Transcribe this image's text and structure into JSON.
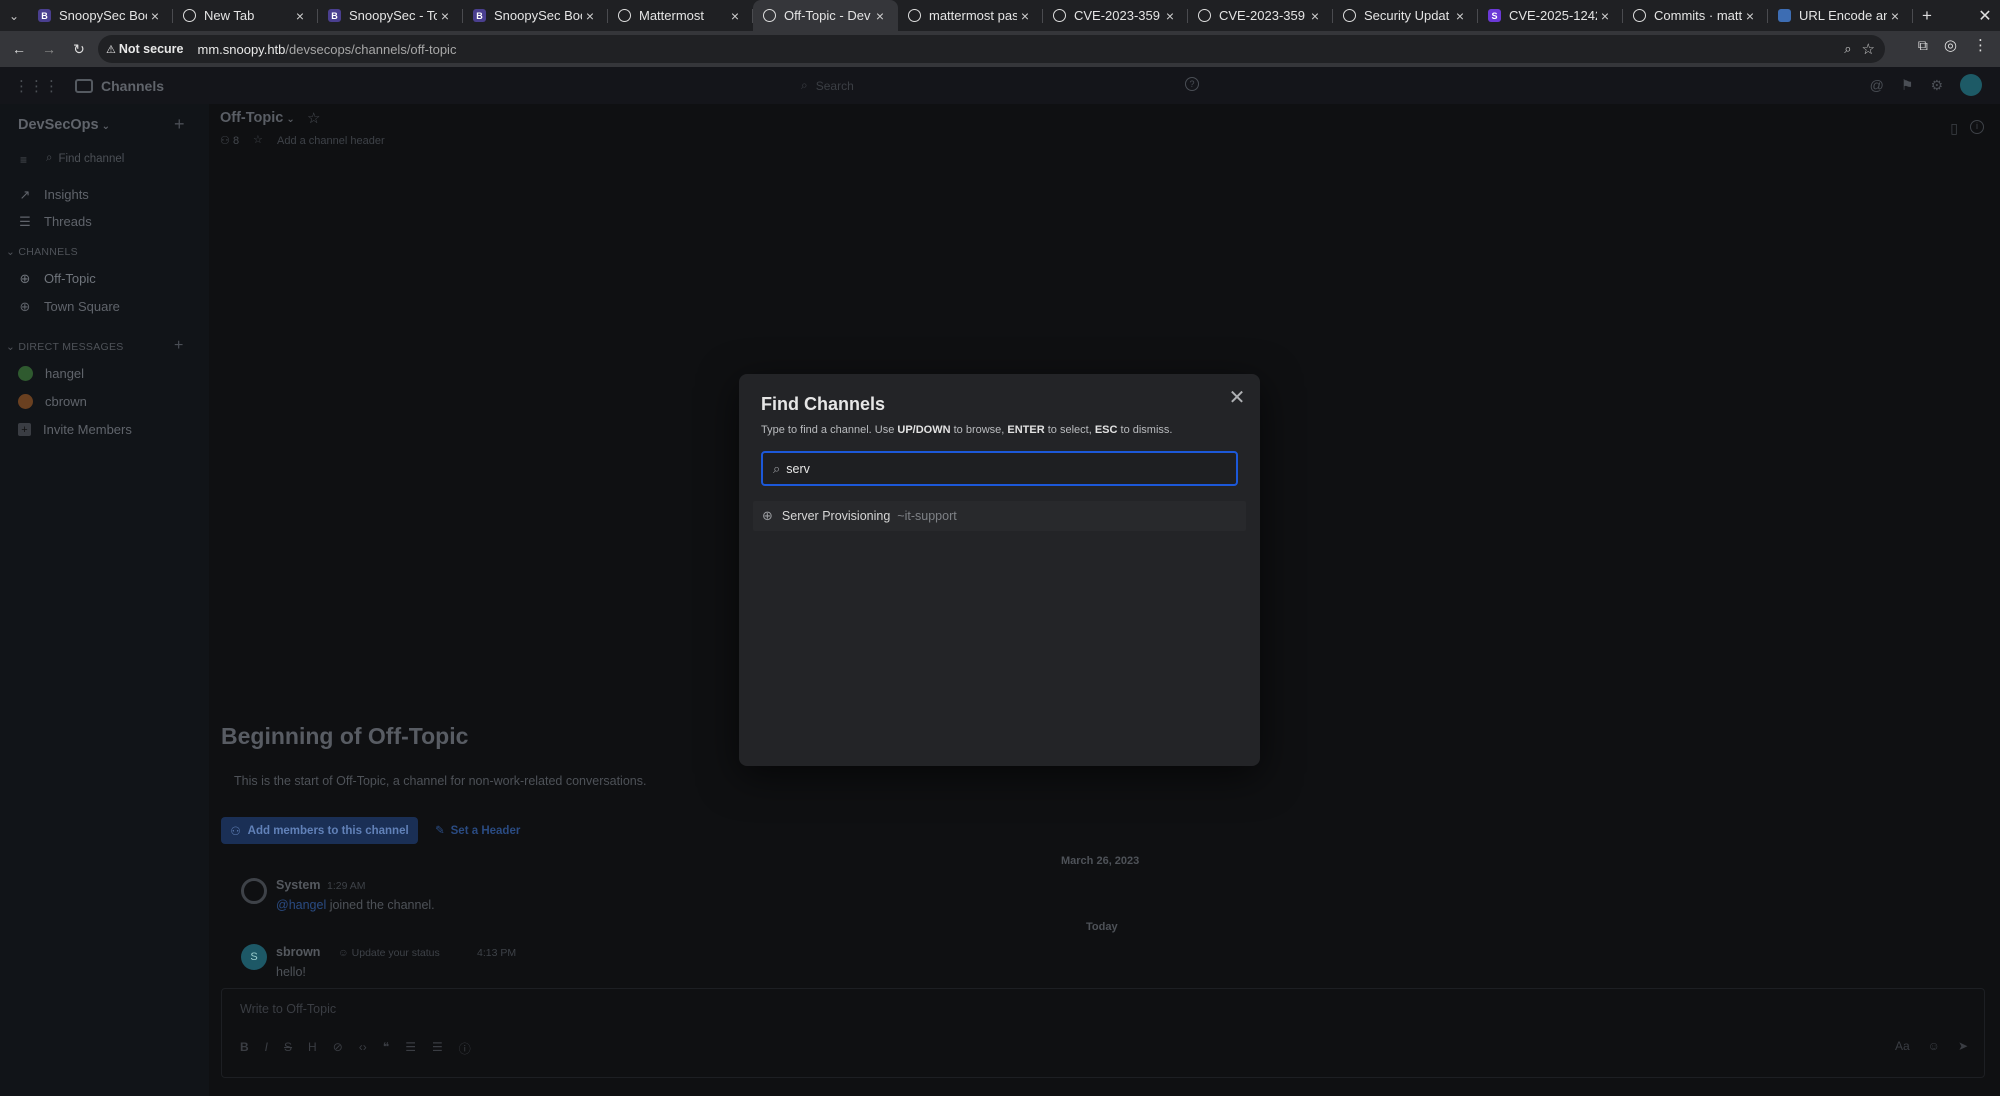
{
  "browser": {
    "tabs": [
      {
        "title": "SnoopySec Boo",
        "favicon": "B",
        "fav_color": "#4a3f8f"
      },
      {
        "title": "New Tab",
        "favicon": "chrome",
        "fav_color": "#555"
      },
      {
        "title": "SnoopySec - To",
        "favicon": "B",
        "fav_color": "#4a3f8f"
      },
      {
        "title": "SnoopySec Boo",
        "favicon": "B",
        "fav_color": "#4a3f8f"
      },
      {
        "title": "Mattermost",
        "favicon": "mm",
        "fav_color": "#ddd"
      },
      {
        "title": "Off-Topic - Dev",
        "favicon": "mm",
        "fav_color": "#ddd",
        "active": true
      },
      {
        "title": "mattermost pas",
        "favicon": "G",
        "fav_color": "#fff"
      },
      {
        "title": "CVE-2023-359",
        "favicon": "G",
        "fav_color": "#fff"
      },
      {
        "title": "CVE-2023-359",
        "favicon": "G",
        "fav_color": "#fff"
      },
      {
        "title": "Security Updat",
        "favicon": "mm",
        "fav_color": "#ddd"
      },
      {
        "title": "CVE-2025-1242",
        "favicon": "S",
        "fav_color": "#6b39d6"
      },
      {
        "title": "Commits · matt",
        "favicon": "gh",
        "fav_color": "#fff"
      },
      {
        "title": "URL Encode an",
        "favicon": "url",
        "fav_color": "#3d6db3"
      }
    ],
    "security_label": "Not secure",
    "url_host": "mm.snoopy.htb",
    "url_path": "/devsecops/channels/off-topic"
  },
  "mm": {
    "app_title": "Channels",
    "search_placeholder": "Search",
    "team_name": "DevSecOps",
    "find_channel": "Find channel",
    "insights": "Insights",
    "threads": "Threads",
    "channels_header": "CHANNELS",
    "channels": [
      "Off-Topic",
      "Town Square"
    ],
    "dm_header": "DIRECT MESSAGES",
    "dms": [
      {
        "name": "hangel",
        "color": "#3a7a3a"
      },
      {
        "name": "cbrown",
        "color": "#b0662a"
      }
    ],
    "invite": "Invite Members",
    "channel_name": "Off-Topic",
    "member_count": "8",
    "add_header": "Add a channel header",
    "intro_title": "Beginning of Off-Topic",
    "intro_text": "This is the start of Off-Topic, a channel for non-work-related conversations.",
    "add_members_btn": "Add members to this channel",
    "set_header": "Set a Header",
    "date1": "March 26, 2023",
    "date2": "Today",
    "posts": [
      {
        "author": "System",
        "time": "1:29 AM",
        "mention": "@hangel",
        "text": " joined the channel."
      },
      {
        "author": "sbrown",
        "status": "Update your status",
        "time": "4:13 PM",
        "text": "hello!"
      }
    ],
    "composer_placeholder": "Write to Off-Topic",
    "format_size": "Aa"
  },
  "modal": {
    "title": "Find Channels",
    "hint_pre": "Type to find a channel. Use ",
    "hint_k1": "UP/DOWN",
    "hint_mid1": " to browse, ",
    "hint_k2": "ENTER",
    "hint_mid2": " to select, ",
    "hint_k3": "ESC",
    "hint_post": " to dismiss.",
    "query": "serv",
    "results": [
      {
        "name": "Server Provisioning",
        "handle": "~it-support"
      }
    ]
  }
}
